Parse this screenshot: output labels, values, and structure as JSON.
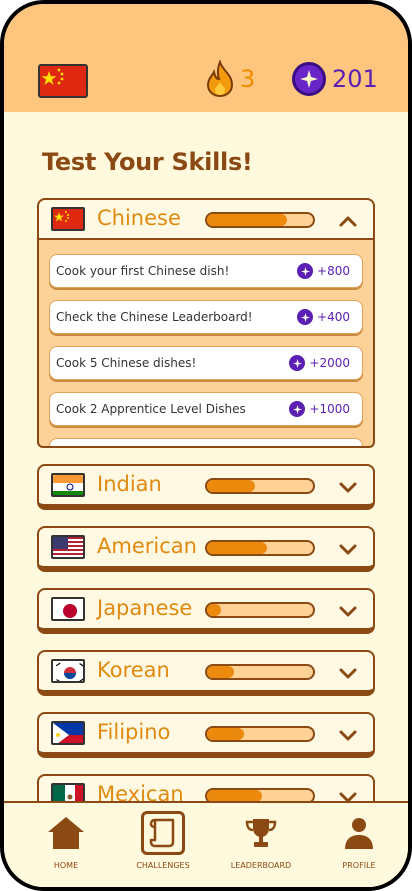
{
  "header": {
    "streak": "3",
    "gems": "201"
  },
  "page_title": "Test Your Skills!",
  "cuisines": [
    {
      "name": "Chinese",
      "flag": "china-flag",
      "progress": 0.75,
      "expanded": true
    },
    {
      "name": "Indian",
      "flag": "india-flag",
      "progress": 0.45,
      "expanded": false
    },
    {
      "name": "American",
      "flag": "usa-flag",
      "progress": 0.57,
      "expanded": false
    },
    {
      "name": "Japanese",
      "flag": "japan-flag",
      "progress": 0.13,
      "expanded": false
    },
    {
      "name": "Korean",
      "flag": "korea-flag",
      "progress": 0.25,
      "expanded": false
    },
    {
      "name": "Filipino",
      "flag": "philippines-flag",
      "progress": 0.35,
      "expanded": false
    },
    {
      "name": "Mexican",
      "flag": "mexico-flag",
      "progress": 0.52,
      "expanded": false
    }
  ],
  "chinese_tasks": [
    {
      "label": "Cook your first Chinese dish!",
      "points": "+800"
    },
    {
      "label": "Check the Chinese Leaderboard!",
      "points": "+400"
    },
    {
      "label": "Cook 5 Chinese dishes!",
      "points": "+2000"
    },
    {
      "label": "Cook 2 Apprentice Level Dishes",
      "points": "+1000"
    }
  ],
  "nav": {
    "home": "HOME",
    "challenges": "CHALLENGES",
    "leaderboard": "LEADERBOARD",
    "profile": "PROFILE"
  },
  "colors": {
    "header_bg": "#fdc57e",
    "page_bg": "#fff9dd",
    "accent_brown": "#8b4a14",
    "accent_orange": "#ec8a0e",
    "gem_purple": "#5b1fb3"
  }
}
